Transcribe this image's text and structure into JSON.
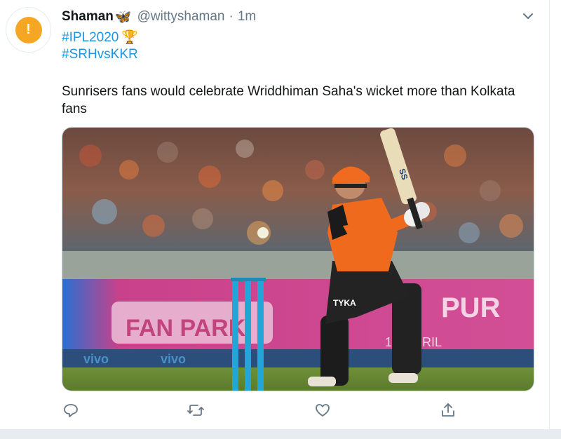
{
  "tweet": {
    "display_name": "Shaman",
    "name_emoji": "🦋",
    "handle": "@wittyshaman",
    "separator": "·",
    "timestamp": "1m",
    "hashtags": [
      "#IPL2020",
      "#SRHvsKKR"
    ],
    "hashtag_emoji": "🏆",
    "text": "Sunrisers fans would celebrate Wriddhiman Saha's wicket more than Kolkata fans",
    "avatar_glyph": "!",
    "photo": {
      "board_text_left": "FAN PARK",
      "board_text_right": "PUR",
      "board_subtext": "1.2 APRIL",
      "sponsor": "vivo",
      "jersey_text": "TYKA",
      "bat_text": "SS"
    }
  },
  "icons": {
    "menu": "chevron-down-icon",
    "reply": "reply-icon",
    "retweet": "retweet-icon",
    "like": "heart-icon",
    "share": "share-icon"
  },
  "colors": {
    "link": "#1b95e0",
    "secondary": "#657786",
    "avatar": "#f5a623",
    "icon": "#657786"
  }
}
